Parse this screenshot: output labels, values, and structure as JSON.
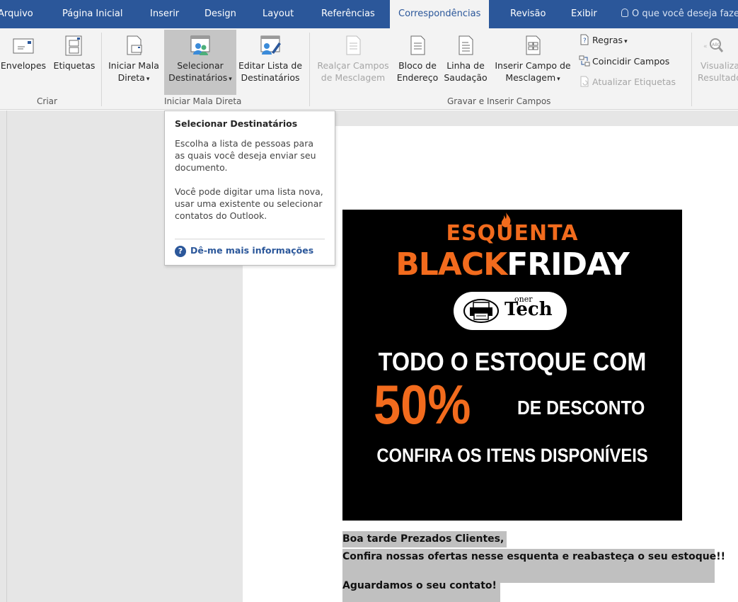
{
  "tabs": [
    {
      "label": "Arquivo",
      "active": false
    },
    {
      "label": "Página Inicial",
      "active": false
    },
    {
      "label": "Inserir",
      "active": false
    },
    {
      "label": "Design",
      "active": false
    },
    {
      "label": "Layout",
      "active": false
    },
    {
      "label": "Referências",
      "active": false
    },
    {
      "label": "Correspondências",
      "active": true
    },
    {
      "label": "Revisão",
      "active": false
    },
    {
      "label": "Exibir",
      "active": false
    }
  ],
  "tell_me": "O que você deseja fazer",
  "ribbon": {
    "groups": {
      "criar": "Criar",
      "iniciar": "Iniciar Mala Direta",
      "gravar": "Gravar e Inserir Campos"
    },
    "buttons": {
      "envelopes": "Envelopes",
      "etiquetas": "Etiquetas",
      "iniciar_mala_1": "Iniciar Mala",
      "iniciar_mala_2": "Direta",
      "selecionar_1": "Selecionar",
      "selecionar_2": "Destinatários",
      "editar_lista_1": "Editar Lista de",
      "editar_lista_2": "Destinatários",
      "realcar_1": "Realçar Campos",
      "realcar_2": "de Mesclagem",
      "bloco_1": "Bloco de",
      "bloco_2": "Endereço",
      "linha_1": "Linha de",
      "linha_2": "Saudação",
      "inserir_campo_1": "Inserir Campo de",
      "inserir_campo_2": "Mesclagem",
      "regras": "Regras",
      "coincidir": "Coincidir Campos",
      "atualizar": "Atualizar Etiquetas",
      "visualizar_1": "Visualizar",
      "visualizar_2": "Resultados"
    }
  },
  "tooltip": {
    "title": "Selecionar Destinatários",
    "para1": "Escolha a lista de pessoas para as quais você deseja enviar seu documento.",
    "para2": "Você pode digitar uma lista nova, usar uma existente ou selecionar contatos do Outlook.",
    "link": "Dê-me mais informações"
  },
  "banner": {
    "esquenta": "ESQUENTA",
    "black": "BLACK",
    "friday": "FRIDAY",
    "logo_sup": "oner",
    "logo_main": "Tech",
    "line1": "TODO O ESTOQUE COM",
    "fifty": "50%",
    "desconto": "DE DESCONTO",
    "line3": "CONFIRA OS ITENS DISPONÍVEIS"
  },
  "document": {
    "line1": "Boa tarde Prezados Clientes,",
    "line2": "Confira nossas ofertas nesse esquenta e reabasteça o seu estoque!!",
    "line3": "Aguardamos o seu contato!"
  },
  "colors": {
    "ribbon_blue": "#2b579a",
    "banner_orange": "#f26b1d"
  }
}
